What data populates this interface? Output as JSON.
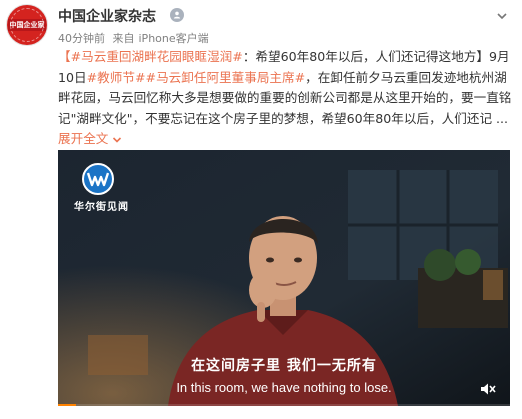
{
  "author": {
    "name": "中国企业家杂志",
    "avatar_text": "中国企业家",
    "avatar_color": "#d4231f",
    "verified_icon": "verified-badge-icon"
  },
  "meta": {
    "time": "40分钟前",
    "source_prefix": "来自",
    "source": "iPhone客户端"
  },
  "post": {
    "topic1": "#马云重回湖畔花园眼眶湿润#",
    "text1": "：希望60年80年以后，人们还记得这地方】9月10日",
    "topic2": "#教师节#",
    "topic3": "#马云卸任阿里董事局主席#",
    "text2": "，在卸任前夕马云重回发迹地杭州湖畔花园，马云回忆称大多是想要做的重要的创新公司都是从这里开始的，要一直铭记\"湖畔文化\"，不要忘记在这个房子里的梦想，希望60年80年以后，人们还记 ...",
    "expand_label": "展开全文",
    "expand_icon": "chevron-down-icon",
    "link_color": "#eb7350"
  },
  "video": {
    "logo_label": "华尔街见闻",
    "subtitle_cn": "在这间房子里  我们一无所有",
    "subtitle_en": "In this room, we have nothing to lose.",
    "progress": 0.04,
    "progress_color": "#ff8200"
  }
}
